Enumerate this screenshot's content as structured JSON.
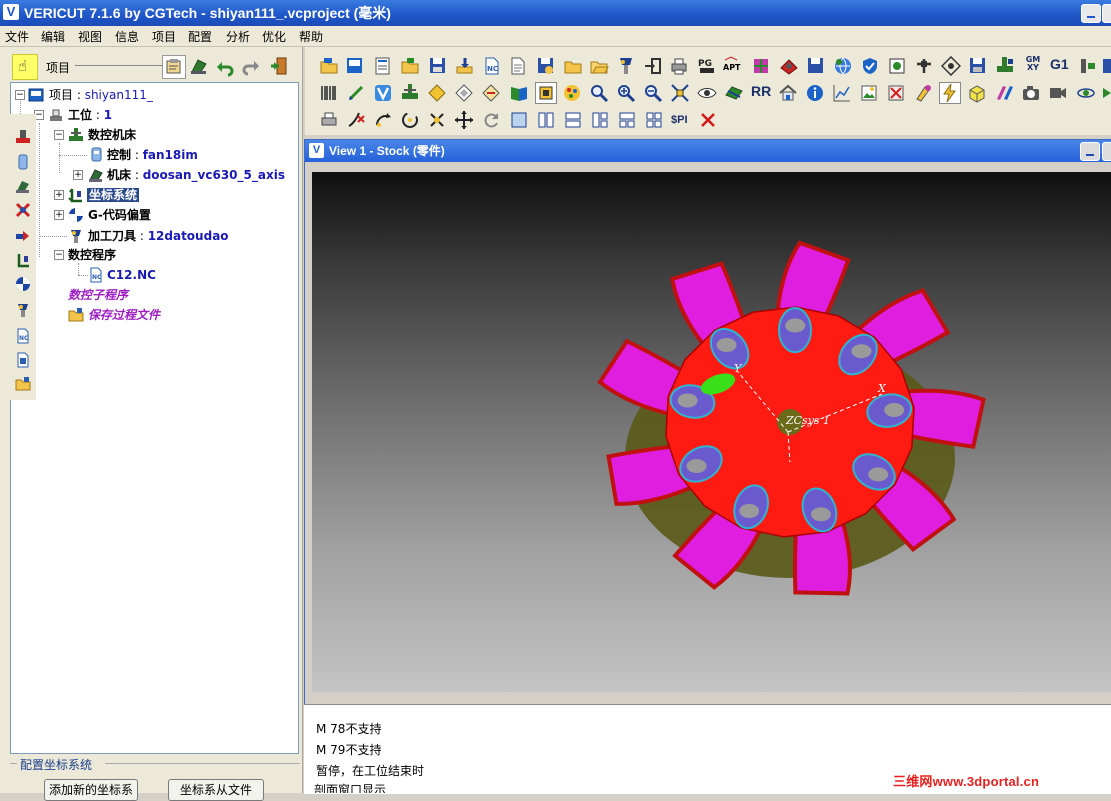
{
  "window": {
    "title": "VERICUT 7.1.6 by CGTech - shiyan111_.vcproject (毫米)",
    "logo_letter": "V"
  },
  "menu": {
    "items": [
      "文件",
      "编辑",
      "视图",
      "信息",
      "项目",
      "配置",
      "分析",
      "优化",
      "帮助"
    ]
  },
  "project_panel": {
    "label": "项目"
  },
  "tree": {
    "root_label": "项目",
    "root_value": "shiyan111_",
    "setup_label": "工位",
    "setup_value": "1",
    "cnc_machine": "数控机床",
    "control_label": "控制",
    "control_value": "fan18im",
    "machine_label": "机床",
    "machine_value": "doosan_vc630_5_axis",
    "coord_system": "坐标系统",
    "gcode_offsets": "G-代码偏置",
    "tooling_label": "加工刀具",
    "tooling_value": "12datoudao",
    "nc_programs": "数控程序",
    "nc_file": "C12.NC",
    "nc_subroutines": "数控子程序",
    "saved_files": "保存过程文件",
    "sep": " : "
  },
  "config_section": {
    "caption": "配置坐标系统",
    "add_button": "添加新的坐标系",
    "from_file_button": "坐标系从文件"
  },
  "toolbar_text": {
    "apt": "APT",
    "gxy_top": "GM",
    "gxy_bottom": "XY",
    "g1": "G1",
    "rr": "RR",
    "spi": "$PI"
  },
  "view": {
    "title": "View 1 - Stock (零件)",
    "csys_label": "ZCsys 1",
    "axis_x": "X",
    "axis_y": "Y"
  },
  "log": {
    "lines": [
      "M 78不支持",
      "M 79不支持",
      "暂停，在工位结束时"
    ]
  },
  "status": {
    "text": "剖面窗口显示"
  },
  "watermark": {
    "text": "三维网www.3dportal.cn"
  },
  "colors": {
    "title_bar": "#1f55c8",
    "blade": "#e01ee0",
    "hub": "#ff1a12",
    "bore": "#6a5acd",
    "selection": "#2a4a8c"
  }
}
